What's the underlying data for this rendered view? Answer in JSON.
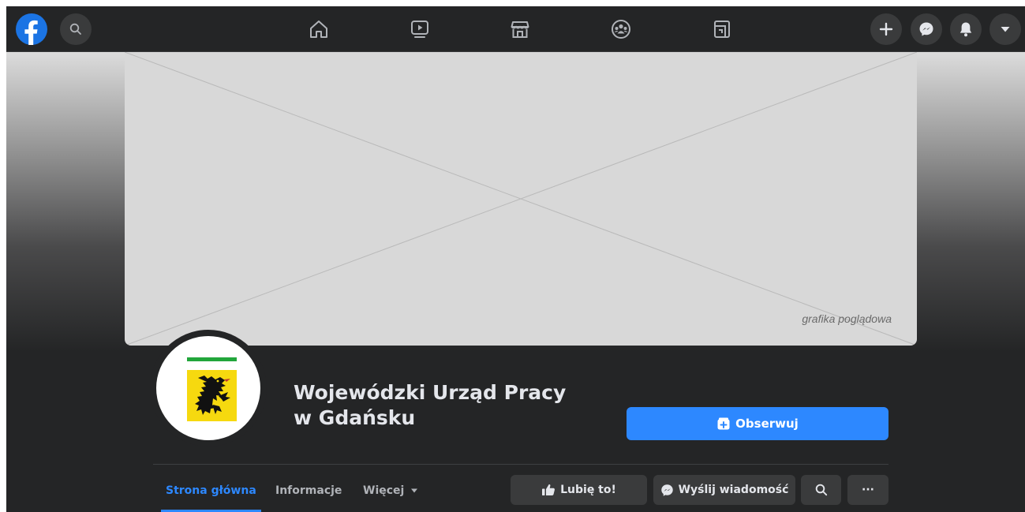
{
  "topbar": {
    "logo": "facebook-logo-icon",
    "search_icon": "search-icon",
    "nav_icons": [
      "home-icon",
      "watch-icon",
      "marketplace-icon",
      "groups-icon",
      "gaming-icon"
    ],
    "right_icons": [
      "plus-icon",
      "messenger-icon",
      "bell-icon",
      "caret-down-icon"
    ]
  },
  "cover": {
    "caption": "grafika poglądowa"
  },
  "profile": {
    "title_line1": "Wojewódzki Urząd Pracy",
    "title_line2": "w Gdańsku",
    "follow_label": "Obserwuj"
  },
  "tabs": [
    {
      "label": "Strona główna",
      "active": true
    },
    {
      "label": "Informacje",
      "active": false
    },
    {
      "label": "Więcej",
      "active": false
    }
  ],
  "actions": {
    "like_label": "Lubię to!",
    "message_label": "Wyślij wiadomość",
    "search_icon": "search-icon",
    "more_label": "···"
  },
  "colors": {
    "accent": "#2d88ff",
    "facebook_blue": "#1b74e4",
    "background": "#242526",
    "button_bg": "#3a3b3c",
    "text": "#e4e6eb",
    "muted_text": "#b0b3b8",
    "crest_yellow": "#f6d90f",
    "crest_green": "#22a63b"
  }
}
